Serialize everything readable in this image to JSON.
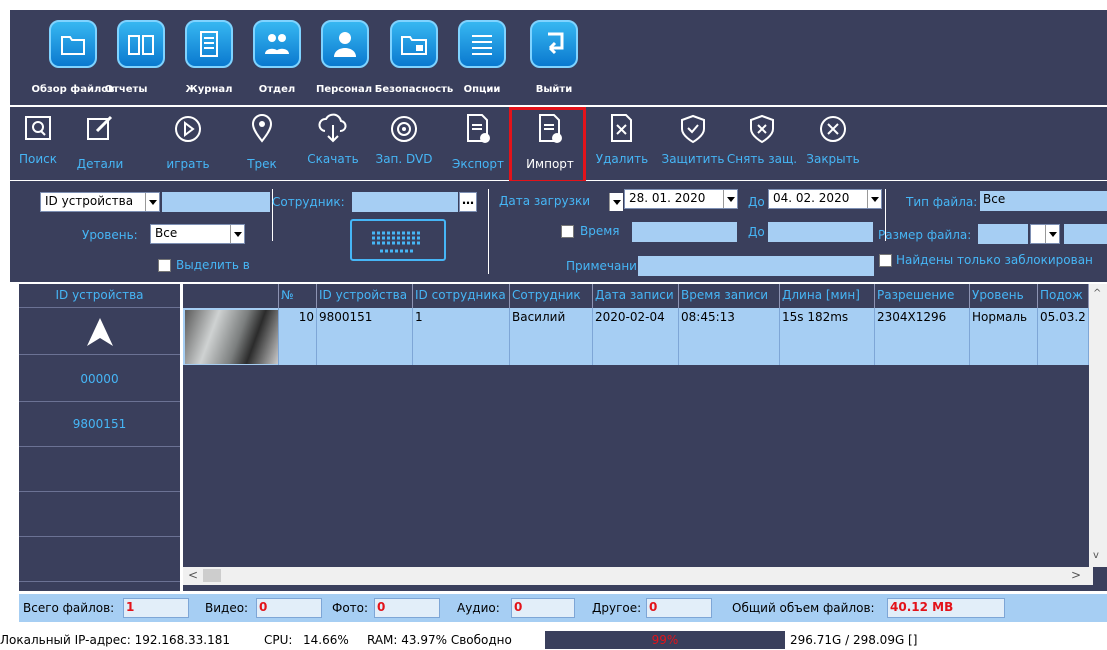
{
  "nav": {
    "items": [
      {
        "label": "Обзор файлов",
        "icon": "folder-icon"
      },
      {
        "label": "Отчеты",
        "icon": "book-icon"
      },
      {
        "label": "Журнал",
        "icon": "notebook-icon"
      },
      {
        "label": "Отдел",
        "icon": "group-icon"
      },
      {
        "label": "Персонал",
        "icon": "person-icon"
      },
      {
        "label": "Безопасность",
        "icon": "lock-folder-icon"
      },
      {
        "label": "Опции",
        "icon": "list-icon"
      },
      {
        "label": "Выйти",
        "icon": "exit-icon"
      }
    ]
  },
  "toolbar": {
    "items": [
      {
        "label": "Поиск",
        "icon": "search-icon"
      },
      {
        "label": "Детали",
        "icon": "edit-icon"
      },
      {
        "label": "играть",
        "icon": "play-icon"
      },
      {
        "label": "Трек",
        "icon": "location-pin-icon"
      },
      {
        "label": "Скачать",
        "icon": "cloud-download-icon"
      },
      {
        "label": "Зап. DVD",
        "icon": "disc-icon"
      },
      {
        "label": "Экспорт",
        "icon": "export-icon"
      },
      {
        "label": "Импорт",
        "icon": "import-icon"
      },
      {
        "label": "Удалить",
        "icon": "delete-icon"
      },
      {
        "label": "Защитить",
        "icon": "protect-icon"
      },
      {
        "label": "Снять защ.",
        "icon": "unprotect-icon"
      },
      {
        "label": "Закрыть",
        "icon": "close-icon"
      }
    ]
  },
  "filters": {
    "device_id_select": "ID устройства",
    "device_id_value": "",
    "level_label": "Уровень:",
    "level_value": "Все",
    "select_label": "Выделить в",
    "employee_label": "Сотрудник:",
    "employee_value": "",
    "upload_date_select": "Дата загрузки",
    "date_from": "28. 01. 2020",
    "date_to_label": "До",
    "date_to": "04. 02. 2020",
    "time_label": "Время",
    "time_to_label": "До",
    "note_label": "Примечани",
    "file_type_label": "Тип файла:",
    "file_type_value": "Все",
    "file_size_label": "Размер файла:",
    "locked_only_label": "Найдены только заблокирован"
  },
  "device_list": {
    "header": "ID устройства",
    "rows": [
      "00000",
      "9800151",
      "",
      "",
      ""
    ]
  },
  "table": {
    "columns": [
      "№",
      "ID устройства",
      "ID сотрудника",
      "Сотрудник",
      "Дата записи",
      "Время записи",
      "Длина [мин]",
      "Разрешение",
      "Уровень",
      "Подож"
    ],
    "rows": [
      {
        "no": "10",
        "device_id": "9800151",
        "employee_id": "1",
        "employee": "Василий",
        "date": "2020-02-04",
        "time": "08:45:13",
        "length": "15s 182ms",
        "resolution": "2304X1296",
        "level": "Нормаль",
        "extra": "05.03.2"
      }
    ]
  },
  "stats": {
    "total_label": "Всего файлов:",
    "total": "1",
    "video_label": "Видео:",
    "video": "0",
    "photo_label": "Фото:",
    "photo": "0",
    "audio_label": "Аудио:",
    "audio": "0",
    "other_label": "Другое:",
    "other": "0",
    "size_label": "Общий объем файлов:",
    "size": "40.12 MB"
  },
  "status": {
    "ip": "Локальный IP-адрес: 192.168.33.181",
    "cpu_label": "CPU:",
    "cpu": "14.66%",
    "ram": "RAM: 43.97% Свободно",
    "disk_percent": "99%",
    "disk": "296.71G / 298.09G []"
  },
  "colors": {
    "panel": "#3a3f5c",
    "accent_text": "#46b6f6",
    "row_highlight": "#a6cef3",
    "alert": "#e3131a"
  }
}
